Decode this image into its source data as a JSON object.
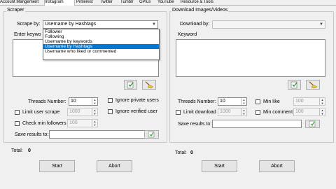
{
  "tabs": [
    "Account Mangement",
    "Instagram",
    "Pinterest",
    "Twitter",
    "Tumblr",
    "GPlus",
    "YouTube",
    "Resource & Tools"
  ],
  "scraper": {
    "group_label": "Scraper",
    "scrape_by_label": "Scrape by:",
    "scrape_by_value": "Username by Hashtags",
    "options": [
      "Follower",
      "Following",
      "Username by keywords",
      "Username by Hashtags",
      "Username who liked or commented"
    ],
    "selected_option": "Username by Hashtags",
    "keyword_label": "Enter keywo",
    "threads_label": "Threads Number:",
    "threads_value": "10",
    "ignore_private": "Ignore private users",
    "ignore_verified": "Ignore verified user",
    "limit_scrape": "Limit user scrape",
    "limit_scrape_value": "1000",
    "check_min_followers": "Check min followers",
    "min_followers_value": "100",
    "save_results_label": "Save results to:",
    "total_label": "Total:",
    "total_value": "0",
    "start_label": "Start",
    "abort_label": "Abort"
  },
  "download": {
    "group_label": "Download Images/Videos",
    "download_by_label": "Download by:",
    "keyword_label": "Keyword",
    "threads_label": "Threads Number:",
    "threads_value": "10",
    "min_like": "Min like",
    "min_like_value": "100",
    "limit_download": "Limit download",
    "limit_download_value": "1000",
    "min_comment": "Min comment",
    "min_comment_value": "100",
    "save_results_label": "Save results to:",
    "total_label": "Total:",
    "total_value": "0",
    "start_label": "Start",
    "abort_label": "Abort"
  },
  "icons": {
    "add_keyword": "add-keyword-icon",
    "clear_keyword": "broom-clear-icon",
    "browse": "folder-browse-icon"
  },
  "colors": {
    "selection": "#0078d7",
    "background": "#f0f0f0"
  }
}
